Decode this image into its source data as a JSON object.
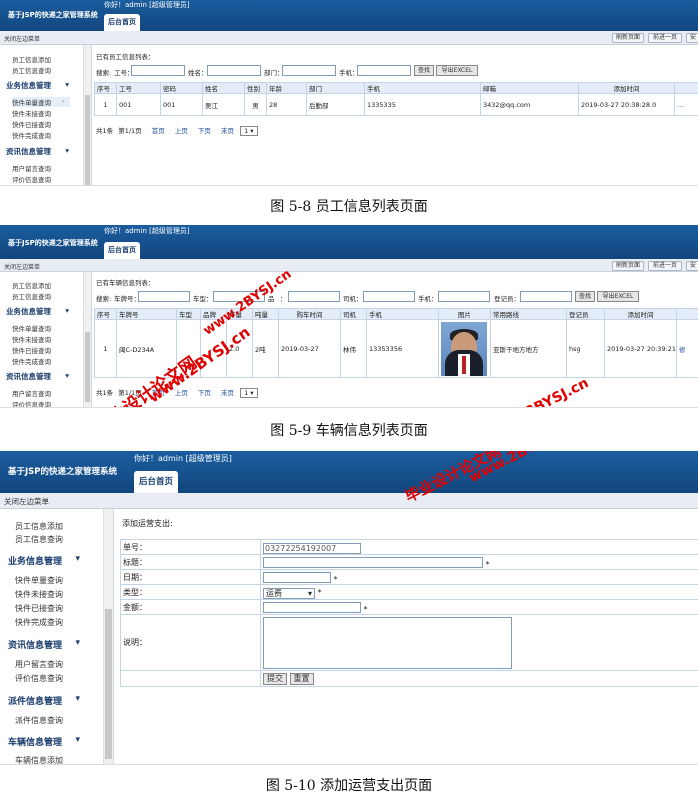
{
  "app": {
    "logo": "基于JSP的快递之家管理系统",
    "greeting": "你好！admin [超级管理员]",
    "home_tab": "后台首页",
    "close_menu": "关闭左边菜单",
    "btn_refresh": "刷新页面",
    "btn_prev": "前进一页",
    "btn_more": "安"
  },
  "shot1": {
    "sidebar": {
      "i1": "员工信息添加",
      "i2": "员工信息查询",
      "h1": "业务信息管理",
      "i3": "快件单量查询",
      "i4": "快件未接查询",
      "i5": "快件已接查询",
      "i6": "快件完成查询",
      "h2": "资讯信息管理",
      "i7": "用户留言查询",
      "i8": "评价信息查询"
    },
    "list_title": "已有员工信息列表：",
    "search": {
      "label": "搜索:",
      "f1": "工号：",
      "f2": "姓名：",
      "f3": "部门：",
      "f4": "手机：",
      "btn_search": "查找",
      "btn_export": "导出EXCEL"
    },
    "headers": [
      "序号",
      "工号",
      "密码",
      "姓名",
      "性别",
      "年龄",
      "部门",
      "手机",
      "邮箱",
      "添加时间"
    ],
    "row": [
      "1",
      "001",
      "001",
      "吴江",
      "男",
      "28",
      "后勤部",
      "1335335",
      "3432@qq.com",
      "2019-03-27 20:38:28.0"
    ],
    "pager": {
      "total": "共1条",
      "page": "第1/1页",
      "first": "首页",
      "prev": "上页",
      "next": "下页",
      "last": "末页",
      "select": "1"
    },
    "caption": "图 5-8 员工信息列表页面"
  },
  "shot2": {
    "sidebar": {
      "i1": "员工信息添加",
      "i2": "员工信息查询",
      "h1": "业务信息管理",
      "i3": "快件单量查询",
      "i4": "快件未接查询",
      "i5": "快件已接查询",
      "i6": "快件完成查询",
      "h2": "资讯信息管理",
      "i7": "用户留言查询",
      "i8": "评价信息查询"
    },
    "list_title": "已有车辆信息列表：",
    "search": {
      "label": "搜索:",
      "f1": "车牌号：",
      "f2": "车型：",
      "f3": "品",
      "f4": "：",
      "f5": "司机：",
      "f6": "手机：",
      "f7": "登记员：",
      "btn_search": "查找",
      "btn_export": "导出EXCEL"
    },
    "headers": [
      "序号",
      "车牌号",
      "车型",
      "品牌",
      "排量",
      "吨量",
      "购车时间",
      "司机",
      "手机",
      "图片",
      "常用路线",
      "登记员",
      "添加时间"
    ],
    "row": [
      "1",
      "闽C-D234A",
      "",
      "",
      "2.0",
      "2吨",
      "2019-03-27",
      "林伟",
      "13353356",
      "",
      "亚斯干地方地方",
      "hsg",
      "2019-03-27 20:39:21.0"
    ],
    "row_action": "修",
    "pager": {
      "total": "共1条",
      "page": "第1/1页",
      "first": "首页",
      "prev": "上页",
      "next": "下页",
      "last": "末页",
      "select": "1"
    },
    "caption": "图 5-9 车辆信息列表页面"
  },
  "shot3": {
    "sidebar": {
      "i1": "员工信息添加",
      "i2": "员工信息查询",
      "h1": "业务信息管理",
      "i3": "快件单量查询",
      "i4": "快件未接查询",
      "i5": "快件已接查询",
      "i6": "快件完成查询",
      "h2": "资讯信息管理",
      "i7": "用户留言查询",
      "i8": "评价信息查询",
      "h3": "派件信息管理",
      "i9": "派件信息查询",
      "h4": "车辆信息管理",
      "i10": "车辆信息添加"
    },
    "form_title": "添加运营支出:",
    "labels": {
      "number": "单号：",
      "title": "标题：",
      "date": "日期：",
      "type": "类型：",
      "amount": "金额：",
      "desc": "说明："
    },
    "number_value": "03272254192007",
    "type_value": "运费",
    "required": "*",
    "btn_submit": "提交",
    "btn_reset": "重置",
    "caption": "图 5-10 添加运营支出页面"
  },
  "watermark": {
    "text1": "毕业设计论文网",
    "text2": "www.2BYSJ.cn",
    "color": "#e00000"
  }
}
